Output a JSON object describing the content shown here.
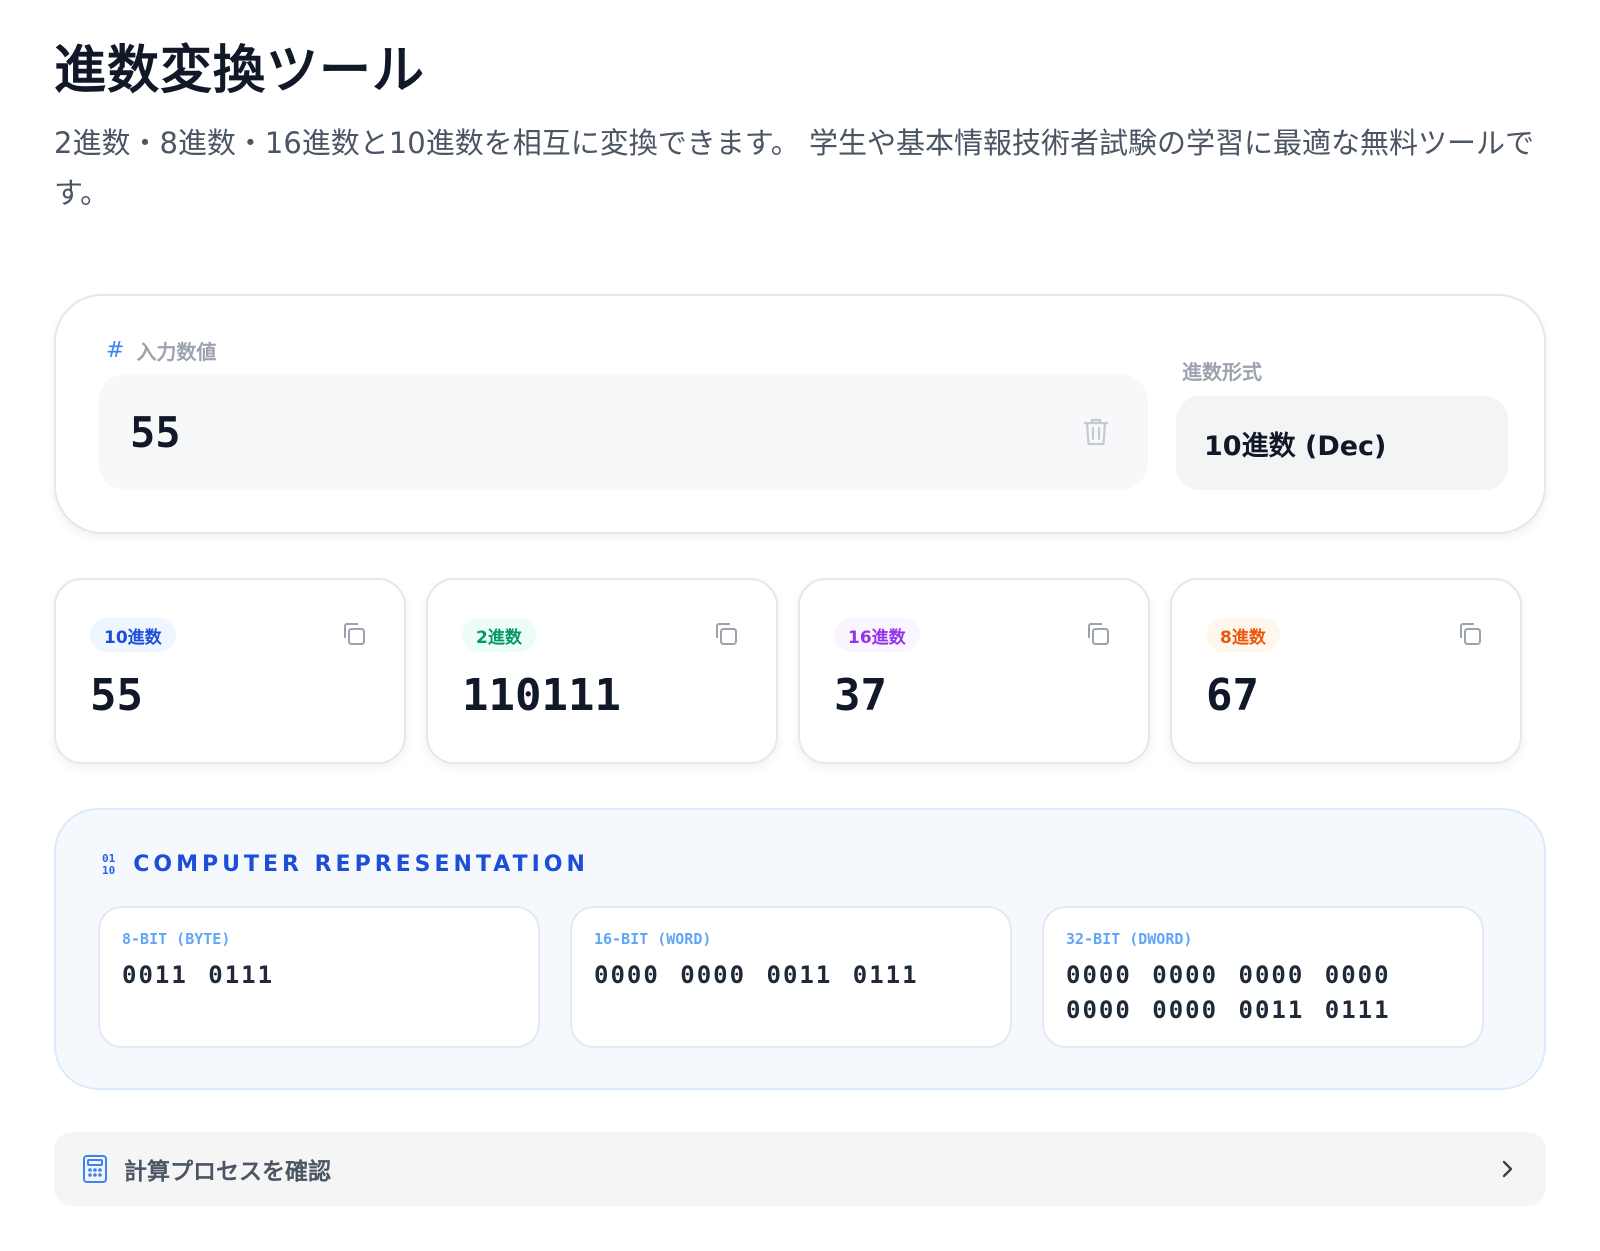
{
  "header": {
    "title": "進数変換ツール",
    "description": "2進数・8進数・16進数と10進数を相互に変換できます。 学生や基本情報技術者試験の学習に最適な無料ツールです。"
  },
  "input": {
    "label": "入力数値",
    "label_icon": "hash-icon",
    "value": "55",
    "clear_icon": "trash-icon"
  },
  "base": {
    "label": "進数形式",
    "selected": "10進数 (Dec)"
  },
  "results": [
    {
      "label": "10進数",
      "value": "55",
      "badge_bg": "#eff6ff",
      "badge_color": "#1d4ed8"
    },
    {
      "label": "2進数",
      "value": "110111",
      "badge_bg": "#ecfdf5",
      "badge_color": "#059669"
    },
    {
      "label": "16進数",
      "value": "37",
      "badge_bg": "#faf5ff",
      "badge_color": "#9333ea"
    },
    {
      "label": "8進数",
      "value": "67",
      "badge_bg": "#fff7ed",
      "badge_color": "#ea580c"
    }
  ],
  "representation": {
    "title": "COMPUTER REPRESENTATION",
    "icon_text": "01\n10",
    "boxes": [
      {
        "label": "8-BIT (BYTE)",
        "value": "0011 0111"
      },
      {
        "label": "16-BIT (WORD)",
        "value": "0000 0000 0011 0111"
      },
      {
        "label": "32-BIT (DWORD)",
        "value": "0000 0000 0000 0000 0000 0000 0011 0111"
      }
    ]
  },
  "process": {
    "label": "計算プロセスを確認",
    "icon": "calculator-icon",
    "chevron": "chevron-right-icon"
  },
  "colors": {
    "accent": "#2563eb",
    "muted": "#9ca3af"
  }
}
